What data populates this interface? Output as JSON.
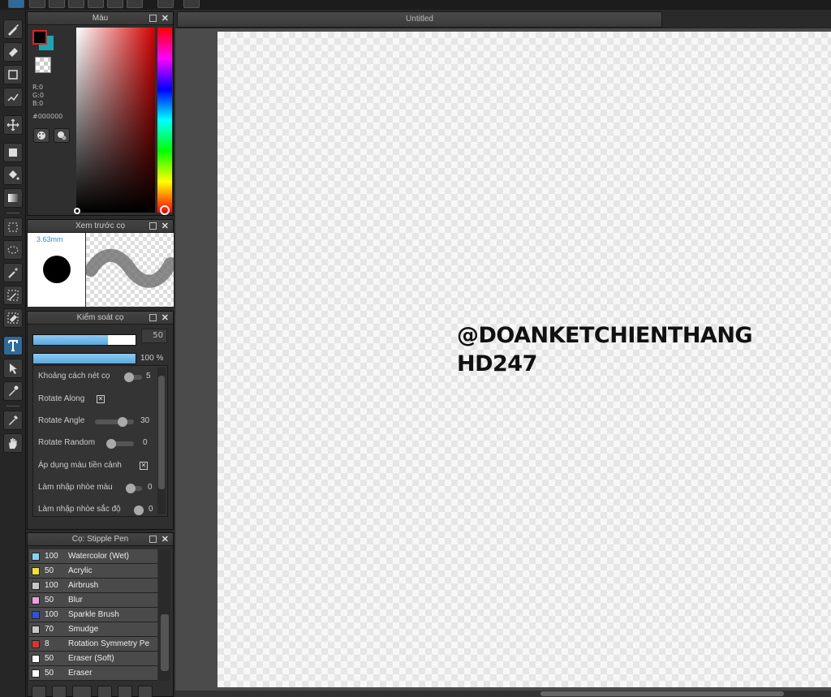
{
  "document": {
    "tab_title": "Untitled"
  },
  "color_panel": {
    "title": "Màu",
    "r": "R:0",
    "g": "G:0",
    "b": "B:0",
    "hex": "#000000",
    "foreground": "#000000",
    "background": "#1aa8b0"
  },
  "brush_preview": {
    "title": "Xem trước cọ",
    "size": "3.63mm"
  },
  "brush_control": {
    "title": "Kiểm soát cọ",
    "size_value": "50",
    "size_fraction": 0.73,
    "opacity_value": "100 %",
    "opacity_fraction": 1.0,
    "settings": [
      {
        "label": "Khoảng cách nét cọ",
        "type": "slider",
        "value": "5"
      },
      {
        "label": "Rotate Along",
        "type": "checkbox",
        "checked": true
      },
      {
        "label": "Rotate Angle",
        "type": "slider",
        "value": "30"
      },
      {
        "label": "Rotate Random",
        "type": "slider",
        "value": "0"
      },
      {
        "label": "Áp dụng màu tiền cảnh",
        "type": "checkbox",
        "checked": true
      },
      {
        "label": "Làm nhập nhòe màu",
        "type": "slider",
        "value": "0"
      },
      {
        "label": "Làm nhập nhòe sắc độ",
        "type": "slider",
        "value": "0"
      }
    ]
  },
  "brush_list": {
    "title": "Cọ: Stipple Pen",
    "items": [
      {
        "size": "100",
        "name": "Watercolor (Wet)",
        "color": "#7fd4f0"
      },
      {
        "size": "50",
        "name": "Acrylic",
        "color": "#f0e030"
      },
      {
        "size": "100",
        "name": "Airbrush",
        "color": "#c8c8c8"
      },
      {
        "size": "50",
        "name": "Blur",
        "color": "#f0a0e0"
      },
      {
        "size": "100",
        "name": "Sparkle Brush",
        "color": "#3050e0"
      },
      {
        "size": "70",
        "name": "Smudge",
        "color": "#c8c8c8"
      },
      {
        "size": "8",
        "name": "Rotation Symmetry Pe",
        "color": "#e03030"
      },
      {
        "size": "50",
        "name": "Eraser (Soft)",
        "color": "#ffffff"
      },
      {
        "size": "50",
        "name": "Eraser",
        "color": "#ffffff"
      }
    ]
  },
  "canvas": {
    "text_line1": "@DOANKETCHIENTHANG",
    "text_line2": "HD247"
  }
}
